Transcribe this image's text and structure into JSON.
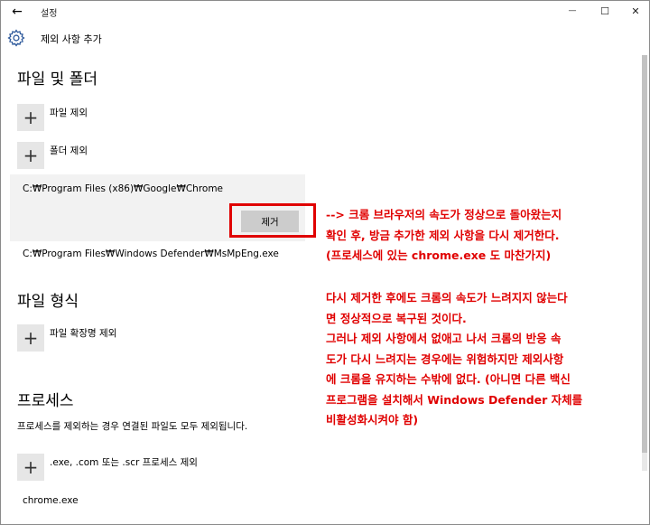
{
  "window": {
    "title": "설정",
    "back_glyph": "←",
    "minimize_glyph": "—",
    "maximize_glyph": "☐",
    "close_glyph": "✕"
  },
  "header": {
    "icon": "gear-icon",
    "title": "제외 사항 추가"
  },
  "files_section": {
    "title": "파일 및 폴더",
    "add_file_label": "파일 제외",
    "add_folder_label": "폴더 제외",
    "selected_item": {
      "path": "C:₩Program Files (x86)₩Google₩Chrome",
      "remove_label": "제거"
    },
    "items": [
      "C:₩Program Files₩Windows Defender₩MsMpEng.exe"
    ]
  },
  "filetype_section": {
    "title": "파일 형식",
    "add_label": "파일 확장명 제외"
  },
  "process_section": {
    "title": "프로세스",
    "description": "프로세스를 제외하는 경우 연결된 파일도 모두 제외됩니다.",
    "add_label": ".exe, .com 또는 .scr 프로세스 제외",
    "items": [
      "chrome.exe"
    ]
  },
  "plus_glyph": "+",
  "annotation": {
    "color": "#e00000",
    "block1": [
      "--> 크롬 브라우저의 속도가 정상으로 돌아왔는지",
      "확인 후, 방금 추가한 제외 사항을 다시 제거한다.",
      "(프로세스에 있는 chrome.exe 도 마찬가지)"
    ],
    "block2": [
      "다시 제거한 후에도 크롬의 속도가 느려지지 않는다",
      "면 정상적으로 복구된 것이다.",
      "그러나 제외 사항에서 없애고 나서 크롬의 반응 속",
      "도가 다시 느려지는 경우에는 위험하지만 제외사항",
      "에 크롬을 유지하는 수밖에 없다. (아니면 다른 백신",
      "프로그램을 설치해서 Windows Defender 자체를",
      "비활성화시켜야 함)"
    ]
  }
}
